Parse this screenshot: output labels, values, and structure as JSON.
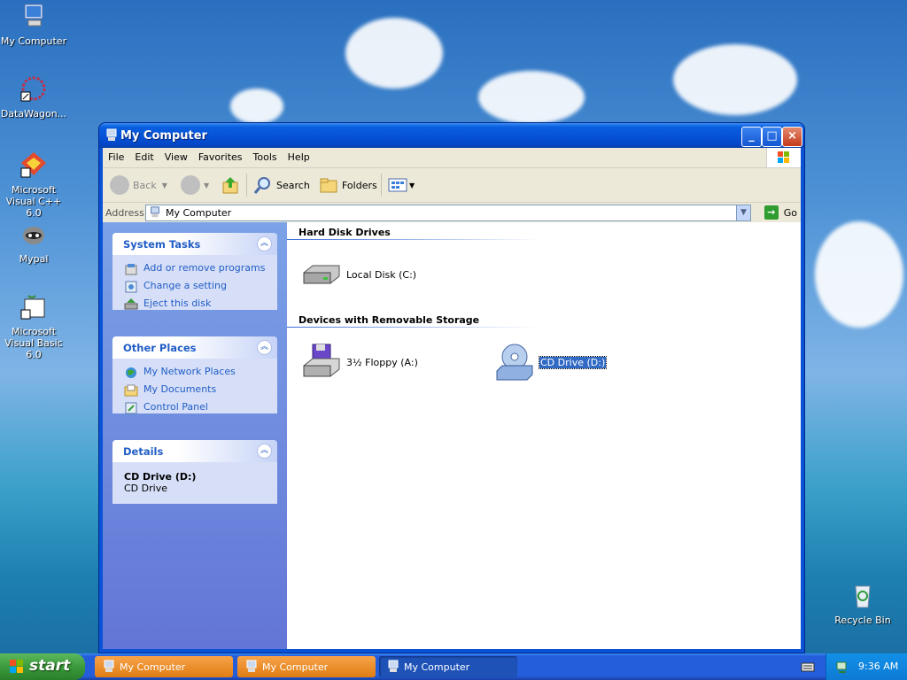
{
  "desktop": {
    "icons": [
      {
        "label": "My Computer"
      },
      {
        "label": "DataWagon..."
      },
      {
        "label": "Microsoft Visual C++ 6.0"
      },
      {
        "label": "Mypal"
      },
      {
        "label": "Microsoft Visual Basic 6.0"
      },
      {
        "label": "Recycle Bin"
      }
    ]
  },
  "window": {
    "title": "My Computer",
    "menu": [
      "File",
      "Edit",
      "View",
      "Favorites",
      "Tools",
      "Help"
    ],
    "toolbar": {
      "back": "Back",
      "search": "Search",
      "folders": "Folders"
    },
    "address": {
      "label": "Address",
      "value": "My Computer",
      "go": "Go"
    },
    "left": {
      "system_tasks": {
        "title": "System Tasks",
        "items": [
          "Add or remove programs",
          "Change a setting",
          "Eject this disk"
        ]
      },
      "other_places": {
        "title": "Other Places",
        "items": [
          "My Network Places",
          "My Documents",
          "Control Panel"
        ]
      },
      "details": {
        "title": "Details",
        "name": "CD Drive (D:)",
        "type": "CD Drive"
      }
    },
    "groups": {
      "hard_disks": {
        "title": "Hard Disk Drives",
        "items": [
          "Local Disk (C:)"
        ]
      },
      "removable": {
        "title": "Devices with Removable Storage",
        "items": [
          "3½ Floppy (A:)",
          "CD Drive (D:)"
        ]
      }
    }
  },
  "taskbar": {
    "start": "start",
    "tasks": [
      "My Computer",
      "My Computer",
      "My Computer"
    ],
    "clock": "9:36 AM"
  },
  "colors": {
    "selection": "#316ac5",
    "link": "#215dc6",
    "task_orange": "#e8891f",
    "titlebar": "#0654d8"
  }
}
